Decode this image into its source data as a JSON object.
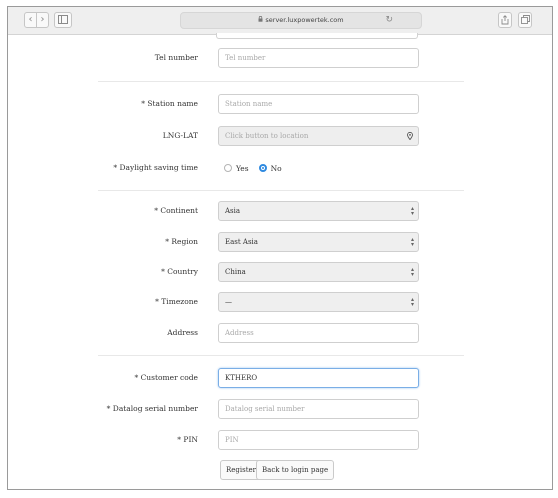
{
  "browser": {
    "url": "server.luxpowertek.com",
    "back_glyph": "‹",
    "forward_glyph": "›",
    "reload_glyph": "↻"
  },
  "form": {
    "tel_number": {
      "label": "Tel number",
      "placeholder": "Tel number"
    },
    "station_name": {
      "label": "* Station name",
      "placeholder": "Station name"
    },
    "lng_lat": {
      "label": "LNG-LAT",
      "placeholder": "Click button to location",
      "icon": "map-pin-icon"
    },
    "daylight_saving": {
      "label": "* Daylight saving time",
      "options": [
        "Yes",
        "No"
      ],
      "selected": "No"
    },
    "continent": {
      "label": "* Continent",
      "value": "Asia"
    },
    "region": {
      "label": "* Region",
      "value": "East Asia"
    },
    "country": {
      "label": "* Country",
      "value": "China"
    },
    "timezone": {
      "label": "* Timezone",
      "value": "—"
    },
    "address": {
      "label": "Address",
      "placeholder": "Address"
    },
    "customer_code": {
      "label": "* Customer code",
      "value": "KTHERO"
    },
    "datalog_serial": {
      "label": "* Datalog serial number",
      "placeholder": "Datalog serial number"
    },
    "pin": {
      "label": "* PIN",
      "placeholder": "PIN"
    },
    "register_label": "Register",
    "back_label": "Back to login page"
  },
  "colors": {
    "accent": "#2f8ae0",
    "focus_border": "#7aaee6"
  }
}
